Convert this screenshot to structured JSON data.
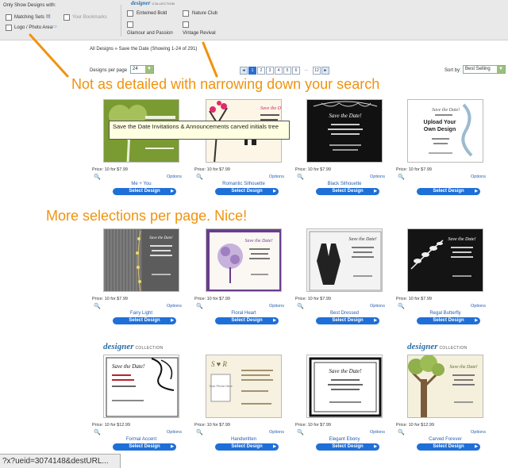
{
  "filters": {
    "label": "Only Show Designs with:",
    "col1": [
      "Matching Sets",
      "Logo / Photo Area"
    ],
    "col1b": "Your Bookmarks",
    "brand": "designer",
    "brand_sub": "COLLECTION",
    "col2": [
      "Entwined Bold",
      "Glamour and Passion"
    ],
    "col3": [
      "Nature Club",
      "Vintage Revival"
    ]
  },
  "breadcrumb": "All Designs » Save the Date (Showing 1-24 of 291)",
  "toolbar": {
    "per_page_label": "Designs per page",
    "per_page_value": "24",
    "pages": [
      "1",
      "2",
      "3",
      "4",
      "5",
      "6"
    ],
    "last_page": "12",
    "dots": "...",
    "sort_label": "Sort by:",
    "sort_value": "Best Selling"
  },
  "annotations": {
    "a1": "Not as detailed with narrowing down your search",
    "a2": "More selections per page.  Nice!"
  },
  "tooltip": "Save the Date Invitations & Announcements carved initials tree",
  "cards": [
    {
      "name": "Me + You",
      "price": "Price: 10 for $7.99"
    },
    {
      "name": "Romantic Silhouette",
      "price": "Price: 10 for $7.99"
    },
    {
      "name": "Black Silhouette",
      "price": "Price: 10 for $7.99"
    },
    {
      "name": "",
      "price": "Price: 10 for $7.99"
    },
    {
      "name": "Fairy Light",
      "price": "Price: 10 for $7.99"
    },
    {
      "name": "Floral Heart",
      "price": "Price: 10 for $7.99"
    },
    {
      "name": "Best Dressed",
      "price": "Price: 10 for $7.99"
    },
    {
      "name": "Regal Butterfly",
      "price": "Price: 10 for $7.99"
    },
    {
      "name": "Formal Accent",
      "price": "Price: 10 for $12.99"
    },
    {
      "name": "Handwritten",
      "price": "Price: 10 for $7.99"
    },
    {
      "name": "Elegant Ebony",
      "price": "Price: 10 for $7.99"
    },
    {
      "name": "Carved Forever",
      "price": "Price: 10 for $12.99"
    }
  ],
  "thumb_text": {
    "save": "Save the Date!",
    "upload1": "Upload Your",
    "upload2": "Own Design",
    "photo": "Your Photo Here"
  },
  "card_ui": {
    "options": "Options",
    "select": "Select Design"
  },
  "status": "?x?ueid=3074148&destURL..."
}
